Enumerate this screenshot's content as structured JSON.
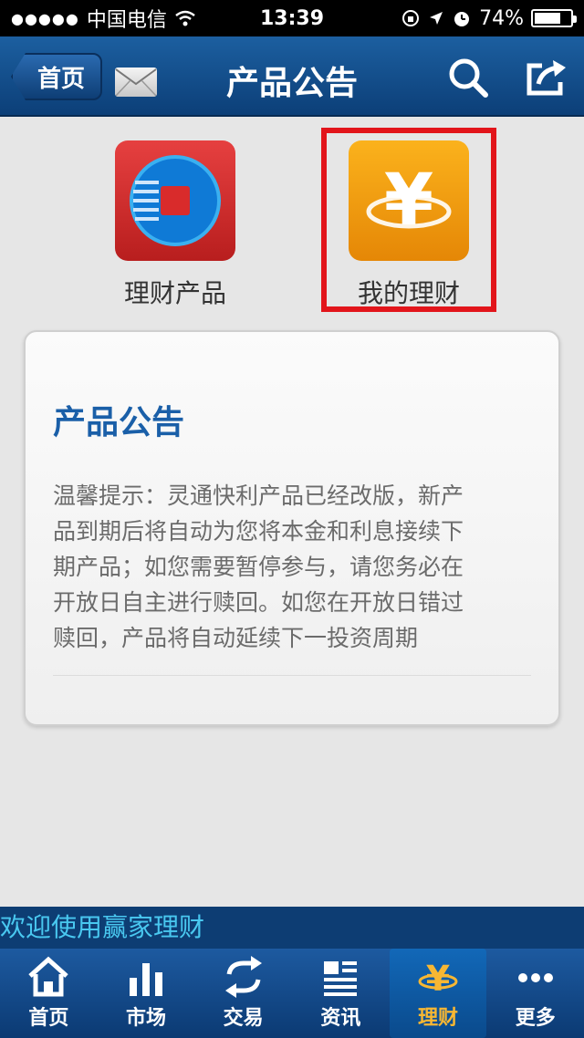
{
  "status_bar": {
    "signal_dots": "●●●●●",
    "carrier": "中国电信",
    "time": "13:39",
    "battery_text": "74%",
    "battery_level": 0.74
  },
  "nav": {
    "back_label": "首页",
    "title": "产品公告"
  },
  "products": [
    {
      "label": "理财产品",
      "icon": "finance-product-icon"
    },
    {
      "label": "我的理财",
      "icon": "yuan-icon"
    }
  ],
  "notice": {
    "title": "产品公告",
    "lines": [
      "温馨提示：灵通快利产品已经改版，新产",
      "品到期后将自动为您将本金和利息接续下",
      "期产品；如您需要暂停参与，请您务必在",
      "开放日自主进行赎回。如您在开放日错过",
      "赎回，产品将自动延续下一投资周期"
    ]
  },
  "marquee_text": "欢迎使用赢家理财",
  "tabs": [
    {
      "label": "首页",
      "icon": "home-icon"
    },
    {
      "label": "市场",
      "icon": "bar-chart-icon"
    },
    {
      "label": "交易",
      "icon": "exchange-icon"
    },
    {
      "label": "资讯",
      "icon": "news-icon"
    },
    {
      "label": "理财",
      "icon": "yuan-icon",
      "active": true
    },
    {
      "label": "更多",
      "icon": "more-icon"
    }
  ],
  "colors": {
    "nav_bg": "#0c3f78",
    "highlight": "#e2151b",
    "notice_title": "#1a5fa8",
    "marquee_text": "#49c8f0",
    "active_tab_label": "#f7b733"
  }
}
